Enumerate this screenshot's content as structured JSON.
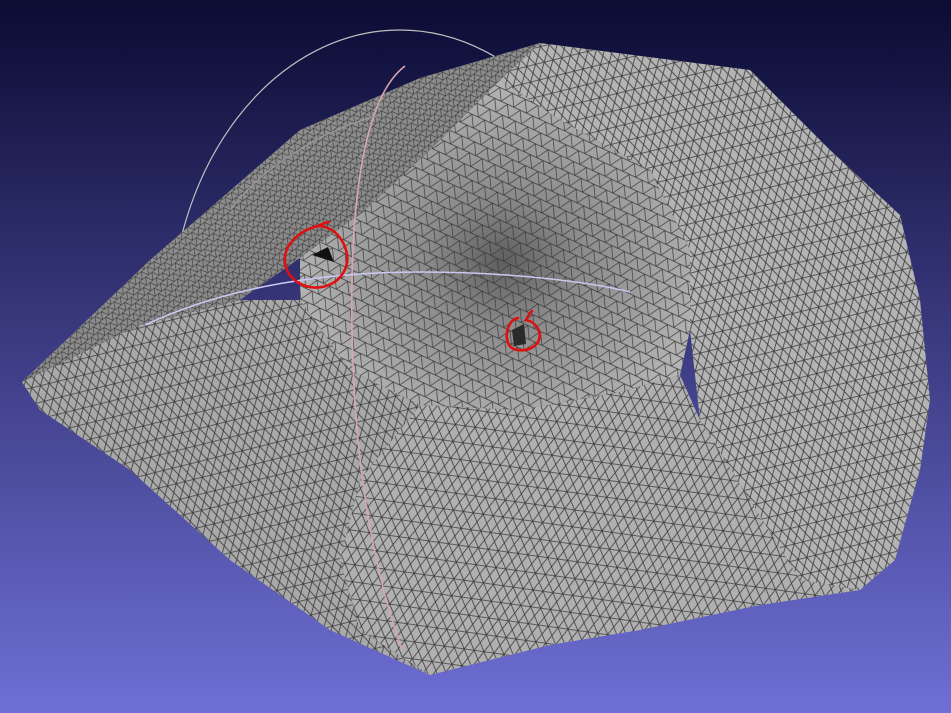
{
  "app": {
    "view": "3d-mesh-viewport"
  },
  "colors": {
    "background_top": "#0b0b33",
    "background_bottom": "#6f6fd6",
    "mesh_fill_light": "#b9b9b9",
    "mesh_fill_mid": "#a4a4a4",
    "mesh_fill_dark": "#6d6d6d",
    "wireframe": "#3c3c3c",
    "annotation": "#e01010",
    "trackball_red": "#d8a6b0",
    "trackball_blue": "#c8c8f0",
    "trackball_green": "#bfbfbf"
  },
  "icons": {
    "trackball": "trackball-rings",
    "annotation": "red-hand-drawn-circle"
  }
}
